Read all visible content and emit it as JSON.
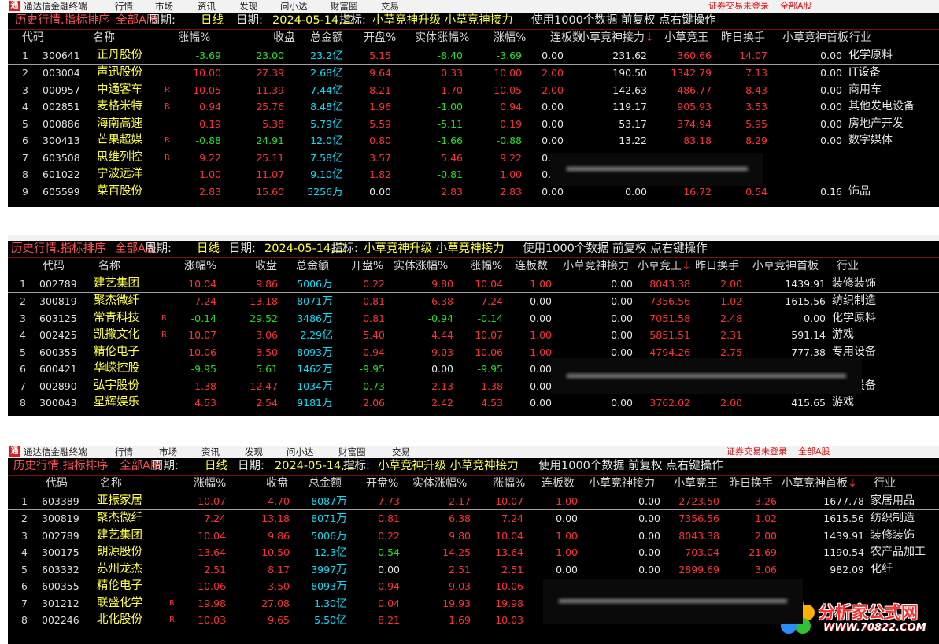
{
  "menubar": {
    "app_name": "通达信金融终端",
    "items": [
      "行情",
      "市场",
      "资讯",
      "发现",
      "问小达",
      "财富圈",
      "交易"
    ],
    "status_login": "证券交易未登录",
    "status_scope": "全部A股"
  },
  "titlebar": {
    "mode": "历史行情.指标排序",
    "scope": "全部A股",
    "period_key": "周期:",
    "period_val": "日线",
    "date_key": "日期:",
    "date_val": "2024-05-14,二",
    "indicator_key": "指标:",
    "indicator_val": "小草竞神升级 小草竞神接力",
    "note": "使用1000个数据 前复权 点右键操作"
  },
  "columns": [
    "代码",
    "名称",
    "涨幅%",
    "收盘",
    "总金额",
    "开盘%",
    "实体涨幅%",
    "涨幅%",
    "连板数",
    "小草竞神接力",
    "小草竞王",
    "昨日换手",
    "小草竞神首板",
    "行业"
  ],
  "sort_arrow": "↓",
  "panels": [
    {
      "sort_col": 9,
      "rows": [
        {
          "idx": "1",
          "code": "300641",
          "name": "正丹股份",
          "flag": "",
          "pct": "-3.69",
          "close": "23.00",
          "amt": "23.2",
          "unit": "亿",
          "open": "5.15",
          "body": "-8.40",
          "pct2": "-3.69",
          "lb": "0.00",
          "jl": "231.62",
          "jw": "360.66",
          "hs": "14.07",
          "sb": "0.00",
          "ind": "化学原料"
        },
        {
          "idx": "2",
          "code": "003004",
          "name": "声迅股份",
          "flag": "",
          "pct": "10.00",
          "close": "27.39",
          "amt": "2.68",
          "unit": "亿",
          "open": "9.64",
          "body": "0.33",
          "pct2": "10.00",
          "lb": "2.00",
          "jl": "190.50",
          "jw": "1342.79",
          "hs": "7.13",
          "sb": "0.00",
          "ind": "IT设备"
        },
        {
          "idx": "3",
          "code": "000957",
          "name": "中通客车",
          "flag": "R",
          "pct": "10.05",
          "close": "11.39",
          "amt": "7.44",
          "unit": "亿",
          "open": "8.21",
          "body": "1.70",
          "pct2": "10.05",
          "lb": "2.00",
          "jl": "142.63",
          "jw": "486.77",
          "hs": "8.43",
          "sb": "0.00",
          "ind": "商用车"
        },
        {
          "idx": "4",
          "code": "002851",
          "name": "麦格米特",
          "flag": "R",
          "pct": "0.94",
          "close": "25.76",
          "amt": "8.48",
          "unit": "亿",
          "open": "1.96",
          "body": "-1.00",
          "pct2": "0.94",
          "lb": "0.00",
          "jl": "119.17",
          "jw": "905.93",
          "hs": "3.53",
          "sb": "0.00",
          "ind": "其他发电设备"
        },
        {
          "idx": "5",
          "code": "000886",
          "name": "海南高速",
          "flag": "",
          "pct": "0.19",
          "close": "5.38",
          "amt": "5.79",
          "unit": "亿",
          "open": "5.59",
          "body": "-5.11",
          "pct2": "0.19",
          "lb": "0.00",
          "jl": "53.17",
          "jw": "374.94",
          "hs": "5.95",
          "sb": "0.00",
          "ind": "房地产开发"
        },
        {
          "idx": "6",
          "code": "300413",
          "name": "芒果超媒",
          "flag": "R",
          "pct": "-0.88",
          "close": "24.91",
          "amt": "12.0",
          "unit": "亿",
          "open": "0.80",
          "body": "-1.66",
          "pct2": "-0.88",
          "lb": "0.00",
          "jl": "13.22",
          "jw": "83.18",
          "hs": "8.29",
          "sb": "0.00",
          "ind": "数字媒体"
        },
        {
          "idx": "7",
          "code": "603508",
          "name": "思维列控",
          "flag": "R",
          "pct": "9.22",
          "close": "25.11",
          "amt": "7.58",
          "unit": "亿",
          "open": "3.57",
          "body": "5.46",
          "pct2": "9.22",
          "lb": "0.00",
          "jl": "",
          "jw": "91.75",
          "hs": "",
          "sb": "",
          "ind": ""
        },
        {
          "idx": "8",
          "code": "601022",
          "name": "宁波远洋",
          "flag": "",
          "pct": "1.00",
          "close": "11.07",
          "amt": "9.10",
          "unit": "亿",
          "open": "1.82",
          "body": "-0.81",
          "pct2": "1.00",
          "lb": "0.00",
          "jl": "",
          "jw": "91.87",
          "hs": "",
          "sb": "",
          "ind": ""
        },
        {
          "idx": "9",
          "code": "605599",
          "name": "菜百股份",
          "flag": "",
          "pct": "2.83",
          "close": "15.60",
          "amt": "5256",
          "unit": "万",
          "open": "0.00",
          "body": "2.83",
          "pct2": "2.83",
          "lb": "0.00",
          "jl": "0.00",
          "jw": "16.72",
          "hs": "0.54",
          "sb": "0.16",
          "ind": "饰品"
        }
      ]
    },
    {
      "sort_col": 10,
      "rows": [
        {
          "idx": "1",
          "code": "002789",
          "name": "建艺集团",
          "flag": "",
          "pct": "10.04",
          "close": "9.86",
          "amt": "5006",
          "unit": "万",
          "open": "0.22",
          "body": "9.80",
          "pct2": "10.04",
          "lb": "1.00",
          "jl": "0.00",
          "jw": "8043.38",
          "hs": "2.00",
          "sb": "1439.91",
          "ind": "装修装饰"
        },
        {
          "idx": "2",
          "code": "300819",
          "name": "聚杰微纤",
          "flag": "",
          "pct": "7.24",
          "close": "13.18",
          "amt": "8071",
          "unit": "万",
          "open": "0.81",
          "body": "6.38",
          "pct2": "7.24",
          "lb": "0.00",
          "jl": "0.00",
          "jw": "7356.56",
          "hs": "1.02",
          "sb": "1615.56",
          "ind": "纺织制造"
        },
        {
          "idx": "3",
          "code": "603125",
          "name": "常青科技",
          "flag": "R",
          "pct": "-0.14",
          "close": "29.52",
          "amt": "3486",
          "unit": "万",
          "open": "0.81",
          "body": "-0.94",
          "pct2": "-0.14",
          "lb": "0.00",
          "jl": "0.00",
          "jw": "7051.58",
          "hs": "2.48",
          "sb": "0.00",
          "ind": "化学原料"
        },
        {
          "idx": "4",
          "code": "002425",
          "name": "凯撒文化",
          "flag": "R",
          "pct": "10.07",
          "close": "3.06",
          "amt": "2.29",
          "unit": "亿",
          "open": "5.40",
          "body": "4.44",
          "pct2": "10.07",
          "lb": "1.00",
          "jl": "0.00",
          "jw": "5851.51",
          "hs": "2.31",
          "sb": "591.14",
          "ind": "游戏"
        },
        {
          "idx": "5",
          "code": "600355",
          "name": "精伦电子",
          "flag": "",
          "pct": "10.06",
          "close": "3.50",
          "amt": "8093",
          "unit": "万",
          "open": "0.94",
          "body": "9.03",
          "pct2": "10.06",
          "lb": "1.00",
          "jl": "0.00",
          "jw": "4794.26",
          "hs": "2.75",
          "sb": "777.38",
          "ind": "专用设备"
        },
        {
          "idx": "6",
          "code": "600421",
          "name": "华嵘控股",
          "flag": "",
          "pct": "-9.95",
          "close": "5.61",
          "amt": "1462",
          "unit": "万",
          "open": "-9.95",
          "body": "0.00",
          "pct2": "-9.95",
          "lb": "0.00",
          "jl": "",
          "jw": "",
          "hs": "",
          "sb": "",
          "ind": ""
        },
        {
          "idx": "7",
          "code": "002890",
          "name": "弘宇股份",
          "flag": "",
          "pct": "1.38",
          "close": "12.47",
          "amt": "1034",
          "unit": "万",
          "open": "-0.73",
          "body": "2.13",
          "pct2": "1.38",
          "lb": "0.00",
          "jl": "",
          "jw": "",
          "hs": "",
          "sb": "",
          "ind": "专用设备"
        },
        {
          "idx": "8",
          "code": "300043",
          "name": "星辉娱乐",
          "flag": "",
          "pct": "4.53",
          "close": "2.54",
          "amt": "9181",
          "unit": "万",
          "open": "2.06",
          "body": "2.42",
          "pct2": "4.53",
          "lb": "0.00",
          "jl": "0.00",
          "jw": "3762.02",
          "hs": "2.00",
          "sb": "415.65",
          "ind": "游戏"
        }
      ]
    },
    {
      "sort_col": 12,
      "rows": [
        {
          "idx": "1",
          "code": "603389",
          "name": "亚振家居",
          "flag": "",
          "pct": "10.07",
          "close": "4.70",
          "amt": "8087",
          "unit": "万",
          "open": "7.73",
          "body": "2.17",
          "pct2": "10.07",
          "lb": "1.00",
          "jl": "0.00",
          "jw": "2723.50",
          "hs": "3.26",
          "sb": "1677.78",
          "ind": "家居用品"
        },
        {
          "idx": "2",
          "code": "300819",
          "name": "聚杰微纤",
          "flag": "",
          "pct": "7.24",
          "close": "13.18",
          "amt": "8071",
          "unit": "万",
          "open": "0.81",
          "body": "6.38",
          "pct2": "7.24",
          "lb": "0.00",
          "jl": "0.00",
          "jw": "7356.56",
          "hs": "1.02",
          "sb": "1615.56",
          "ind": "纺织制造"
        },
        {
          "idx": "3",
          "code": "002789",
          "name": "建艺集团",
          "flag": "",
          "pct": "10.04",
          "close": "9.86",
          "amt": "5006",
          "unit": "万",
          "open": "0.22",
          "body": "9.80",
          "pct2": "10.04",
          "lb": "1.00",
          "jl": "0.00",
          "jw": "8043.38",
          "hs": "2.00",
          "sb": "1439.91",
          "ind": "装修装饰"
        },
        {
          "idx": "4",
          "code": "300175",
          "name": "朗源股份",
          "flag": "",
          "pct": "13.64",
          "close": "10.50",
          "amt": "12.3",
          "unit": "亿",
          "open": "-0.54",
          "body": "14.25",
          "pct2": "13.64",
          "lb": "1.00",
          "jl": "0.00",
          "jw": "703.04",
          "hs": "21.69",
          "sb": "1190.54",
          "ind": "农产品加工"
        },
        {
          "idx": "5",
          "code": "603332",
          "name": "苏州龙杰",
          "flag": "",
          "pct": "2.51",
          "close": "8.17",
          "amt": "3997",
          "unit": "万",
          "open": "0.00",
          "body": "2.51",
          "pct2": "2.51",
          "lb": "0.00",
          "jl": "0.00",
          "jw": "2899.69",
          "hs": "3.06",
          "sb": "982.09",
          "ind": "化纤"
        },
        {
          "idx": "6",
          "code": "600355",
          "name": "精伦电子",
          "flag": "",
          "pct": "10.06",
          "close": "3.50",
          "amt": "8093",
          "unit": "万",
          "open": "0.94",
          "body": "9.03",
          "pct2": "10.06",
          "lb": "1.00",
          "jl": "0.00",
          "jw": "",
          "hs": "",
          "sb": "",
          "ind": ""
        },
        {
          "idx": "7",
          "code": "301212",
          "name": "联盛化学",
          "flag": "R",
          "pct": "19.98",
          "close": "27.08",
          "amt": "1.30",
          "unit": "亿",
          "open": "0.04",
          "body": "19.93",
          "pct2": "19.98",
          "lb": "1.00",
          "jl": "",
          "jw": "",
          "hs": "",
          "sb": "",
          "ind": ""
        },
        {
          "idx": "8",
          "code": "002246",
          "name": "北化股份",
          "flag": "R",
          "pct": "10.03",
          "close": "9.65",
          "amt": "5.50",
          "unit": "亿",
          "open": "8.21",
          "body": "1.69",
          "pct2": "10.03",
          "lb": "1.00",
          "jl": "0.00",
          "jw": "1103.32",
          "hs": "",
          "sb": "",
          "ind": ""
        }
      ]
    }
  ],
  "watermark": {
    "title": "分析家公式网",
    "url": "WWW.70822.COM"
  }
}
